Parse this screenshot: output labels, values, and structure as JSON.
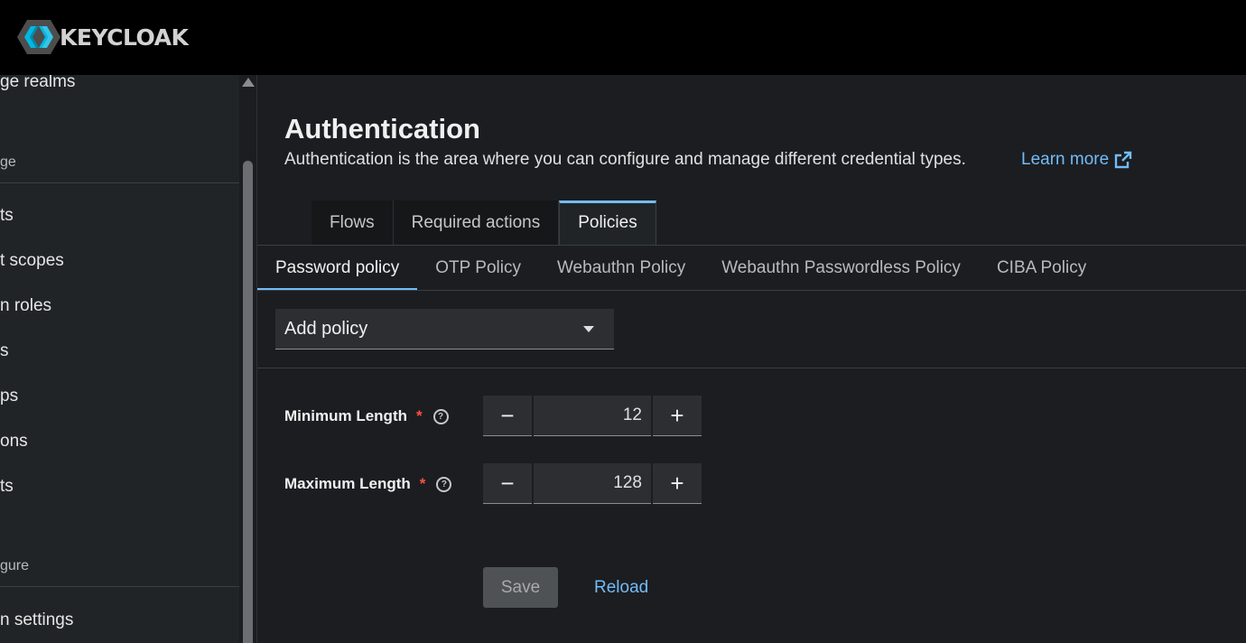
{
  "masthead": {
    "logo_text": "KEYCLOAK"
  },
  "sidebar": {
    "items": [
      {
        "label": "ge realms"
      },
      {
        "label": "ge"
      },
      {
        "label": "ts"
      },
      {
        "label": "t scopes"
      },
      {
        "label": "n roles"
      },
      {
        "label": "s"
      },
      {
        "label": "ps"
      },
      {
        "label": "ons"
      },
      {
        "label": "ts"
      },
      {
        "label": "gure"
      },
      {
        "label": "n settings"
      }
    ]
  },
  "page": {
    "title": "Authentication",
    "description": "Authentication is the area where you can configure and manage different credential types.",
    "learn_more": "Learn more"
  },
  "tabs": [
    {
      "label": "Flows"
    },
    {
      "label": "Required actions"
    },
    {
      "label": "Policies"
    }
  ],
  "subtabs": [
    {
      "label": "Password policy"
    },
    {
      "label": "OTP Policy"
    },
    {
      "label": "Webauthn Policy"
    },
    {
      "label": "Webauthn Passwordless Policy"
    },
    {
      "label": "CIBA Policy"
    }
  ],
  "add_policy": {
    "label": "Add policy"
  },
  "fields": [
    {
      "label": "Minimum Length",
      "required": "*",
      "help": "?",
      "minus": "−",
      "value": "12",
      "plus": "+"
    },
    {
      "label": "Maximum Length",
      "required": "*",
      "help": "?",
      "minus": "−",
      "value": "128",
      "plus": "+"
    }
  ],
  "actions": {
    "save": "Save",
    "reload": "Reload"
  },
  "colors": {
    "accent": "#73bcf7",
    "required": "#fe5142",
    "masthead": "#000000"
  },
  "icons": [
    "keycloak-logo",
    "external-link-icon",
    "caret-down-icon",
    "help-icon",
    "minus-icon",
    "plus-icon",
    "scroll-up-arrow-icon"
  ]
}
